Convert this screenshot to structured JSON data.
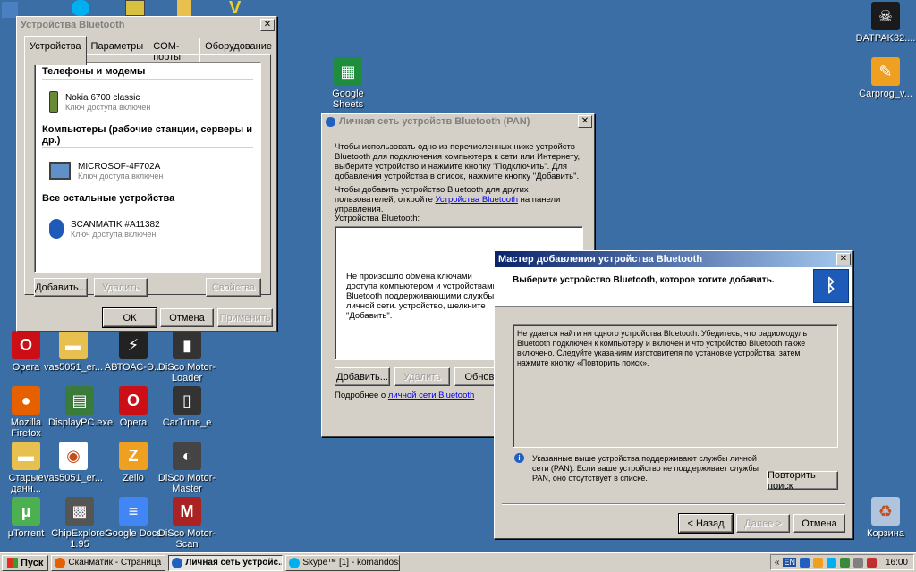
{
  "desktop_icons": [
    {
      "id": "datpak",
      "label": "DATPAK32....",
      "color": "#1a1a1a",
      "glyph": "☠"
    },
    {
      "id": "carprog",
      "label": "Carprog_v...",
      "color": "#f0a020",
      "glyph": "✎"
    },
    {
      "id": "gsheets",
      "label": "Google Sheets",
      "color": "#1e8e3e",
      "glyph": "▦"
    },
    {
      "id": "opera1",
      "label": "Opera",
      "color": "#cc0f16",
      "glyph": "O"
    },
    {
      "id": "vas1",
      "label": "vas5051_er...",
      "color": "#e8c050",
      "glyph": "▬"
    },
    {
      "id": "avtoas",
      "label": "АВТОАС-Э...",
      "color": "#222222",
      "glyph": "⚡"
    },
    {
      "id": "disco1",
      "label": "DiSco Motor-Loader",
      "color": "#333333",
      "glyph": "▮"
    },
    {
      "id": "firefox",
      "label": "Mozilla Firefox",
      "color": "#e66000",
      "glyph": "●"
    },
    {
      "id": "displaypc",
      "label": "DisplayPC.exe",
      "color": "#3a7a3a",
      "glyph": "▤"
    },
    {
      "id": "opera2",
      "label": "Opera",
      "color": "#cc0f16",
      "glyph": "O"
    },
    {
      "id": "cartune",
      "label": "CarTune_e",
      "color": "#333333",
      "glyph": "▯"
    },
    {
      "id": "old",
      "label": "Старые данн...",
      "color": "#e8c050",
      "glyph": "▬"
    },
    {
      "id": "vas2",
      "label": "vas5051_er...",
      "color": "#ffffff",
      "glyph": "◉"
    },
    {
      "id": "zello",
      "label": "Zello",
      "color": "#f0a020",
      "glyph": "Z"
    },
    {
      "id": "disco2",
      "label": "DiSco Motor-Master",
      "color": "#444444",
      "glyph": "◐"
    },
    {
      "id": "utorrent",
      "label": "µTorrent",
      "color": "#4caf50",
      "glyph": "µ"
    },
    {
      "id": "chipexp",
      "label": "ChipExplorer 1.95",
      "color": "#555555",
      "glyph": "▩"
    },
    {
      "id": "gdocs",
      "label": "Google Docs",
      "color": "#4285f4",
      "glyph": "≡"
    },
    {
      "id": "disco3",
      "label": "DiSco Motor-Scan",
      "color": "#aa2222",
      "glyph": "M"
    },
    {
      "id": "recycle",
      "label": "Корзина",
      "color": "#b0c4de",
      "glyph": "♻"
    }
  ],
  "bt_window": {
    "title": "Устройства Bluetooth",
    "tabs": [
      "Устройства",
      "Параметры",
      "COM-порты",
      "Оборудование"
    ],
    "groups": [
      {
        "heading": "Телефоны и модемы",
        "device": "Nokia 6700 classic",
        "sub": "Ключ доступа включен"
      },
      {
        "heading": "Компьютеры (рабочие станции, серверы и др.)",
        "device": "MICROSOF-4F702A",
        "sub": "Ключ доступа включен"
      },
      {
        "heading": "Все остальные устройства",
        "device": "SCANMATIK #A11382",
        "sub": "Ключ доступа включен"
      }
    ],
    "add": "Добавить...",
    "remove": "Удалить",
    "properties": "Свойства",
    "ok": "ОК",
    "cancel": "Отмена",
    "apply": "Применить"
  },
  "pan_window": {
    "title": "Личная сеть устройств Bluetooth (PAN)",
    "intro": "Чтобы использовать одно из перечисленных ниже устройств Bluetooth для подключения компьютера к сети или Интернету, выберите устройство и нажмите кнопку \"Подключить\". Для добавления устройства в список, нажмите кнопку \"Добавить\".",
    "intro2_pre": "Чтобы добавить устройство Bluetooth для других пользователей, откройте",
    "intro2_link": "Устройства Bluetooth",
    "intro2_post": "на панели управления.",
    "list_label": "Устройства Bluetooth:",
    "empty_msg": "Не произошло обмена ключами доступа компьютером и устройствами Bluetooth поддерживающими службы личной сети. устройство, щелкните \"Добавить\".",
    "add": "Добавить...",
    "remove": "Удалить",
    "refresh": "Обнови",
    "more_pre": "Подробнее о",
    "more_link": "личной сети Bluetooth"
  },
  "wizard": {
    "title": "Мастер добавления устройства Bluetooth",
    "header": "Выберите устройство Bluetooth, которое хотите добавить.",
    "notfound": "Не удается найти ни одного устройства Bluetooth. Убедитесь, что радиомодуль Bluetooth подключен к компьютеру и включен и что устройство Bluetooth также включено. Следуйте указаниям изготовителя по установке устройства; затем нажмите кнопку «Повторить поиск».",
    "info": "Указанные выше устройства поддерживают службы личной сети (PAN). Если ваше устройство не поддерживает службы PAN, оно отсутствует в списке.",
    "retry": "Повторить поиск",
    "back": "< Назад",
    "next": "Далее >",
    "cancel": "Отмена"
  },
  "taskbar": {
    "start": "Пуск",
    "tasks": [
      {
        "label": "Сканматик - Страница ...",
        "icon_color": "#e66000"
      },
      {
        "label": "Личная сеть устройс...",
        "icon_color": "#2060c0"
      },
      {
        "label": "Skype™ [1] - komandoss...",
        "icon_color": "#00aff0"
      }
    ],
    "lang": "EN",
    "clock": "16:00"
  }
}
